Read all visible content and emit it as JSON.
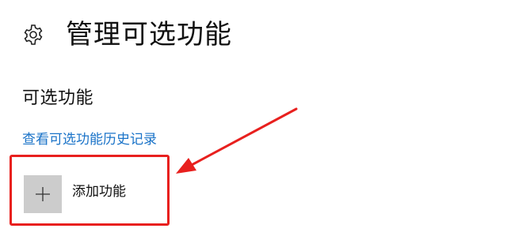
{
  "header": {
    "icon": "gear-icon",
    "title": "管理可选功能"
  },
  "section": {
    "title": "可选功能",
    "history_link": "查看可选功能历史记录"
  },
  "add_feature": {
    "icon": "plus-icon",
    "label": "添加功能"
  },
  "annotation": {
    "color": "#e8201e",
    "box": "highlight-box",
    "arrow": "pointer-arrow"
  },
  "colors": {
    "link": "#1a73c8",
    "button_bg": "#cccccc"
  }
}
